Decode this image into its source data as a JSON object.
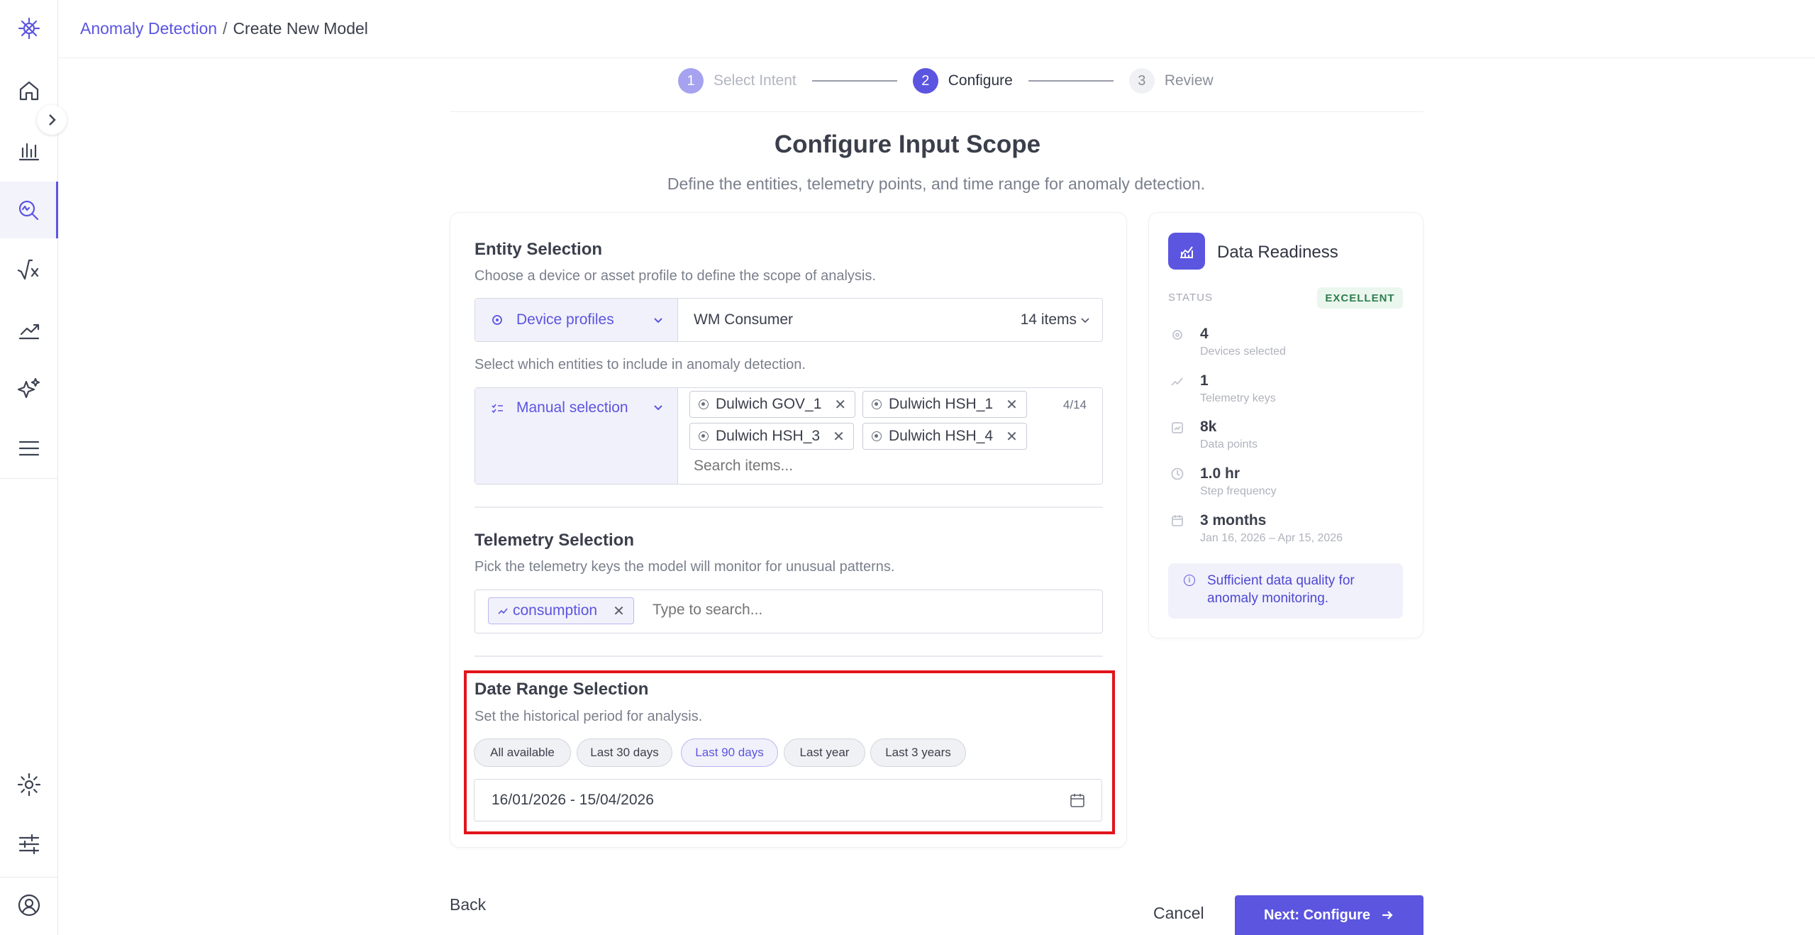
{
  "header": {
    "crumb_link": "Anomaly Detection",
    "crumb_sep": "/",
    "crumb_current": "Create New Model"
  },
  "stepper": {
    "steps": [
      {
        "num": "1",
        "label": "Select Intent",
        "state": "done"
      },
      {
        "num": "2",
        "label": "Configure",
        "state": "active"
      },
      {
        "num": "3",
        "label": "Review",
        "state": "pending"
      }
    ]
  },
  "page": {
    "title": "Configure Input Scope",
    "subtitle": "Define the entities, telemetry points, and time range for anomaly detection."
  },
  "entity": {
    "title": "Entity Selection",
    "desc": "Choose a device or asset profile to define the scope of analysis.",
    "type_label": "Device profiles",
    "profile_value": "WM Consumer",
    "profile_count": "14 items",
    "select_desc": "Select which entities to include in anomaly detection.",
    "mode_label": "Manual selection",
    "counter": "4/14",
    "chips": [
      "Dulwich GOV_1",
      "Dulwich HSH_1",
      "Dulwich HSH_3",
      "Dulwich HSH_4"
    ],
    "search_placeholder": "Search items..."
  },
  "telemetry": {
    "title": "Telemetry Selection",
    "desc": "Pick the telemetry keys the model will monitor for unusual patterns.",
    "chip": "consumption",
    "search_placeholder": "Type to search..."
  },
  "date_range": {
    "title": "Date Range Selection",
    "desc": "Set the historical period for analysis.",
    "presets": [
      "All available",
      "Last 30 days",
      "Last 90 days",
      "Last year",
      "Last 3 years"
    ],
    "selected_preset": "Last 90 days",
    "value": "16/01/2026 - 15/04/2026"
  },
  "readiness": {
    "title": "Data Readiness",
    "status_label": "STATUS",
    "status_value": "EXCELLENT",
    "stats": [
      {
        "value": "4",
        "label": "Devices selected",
        "icon": "device-icon"
      },
      {
        "value": "1",
        "label": "Telemetry keys",
        "icon": "trend-icon"
      },
      {
        "value": "8k",
        "label": "Data points",
        "icon": "chart-icon"
      },
      {
        "value": "1.0 hr",
        "label": "Step frequency",
        "icon": "clock-icon"
      },
      {
        "value": "3 months",
        "label": "Jan 16, 2026 – Apr 15, 2026",
        "icon": "calendar-icon"
      }
    ],
    "info": "Sufficient data quality for anomaly monitoring."
  },
  "footer": {
    "back": "Back",
    "cancel": "Cancel",
    "next": "Next: Configure"
  },
  "colors": {
    "accent": "#5b55e0",
    "highlight": "#e2141c",
    "success": "#2e7d4e"
  }
}
